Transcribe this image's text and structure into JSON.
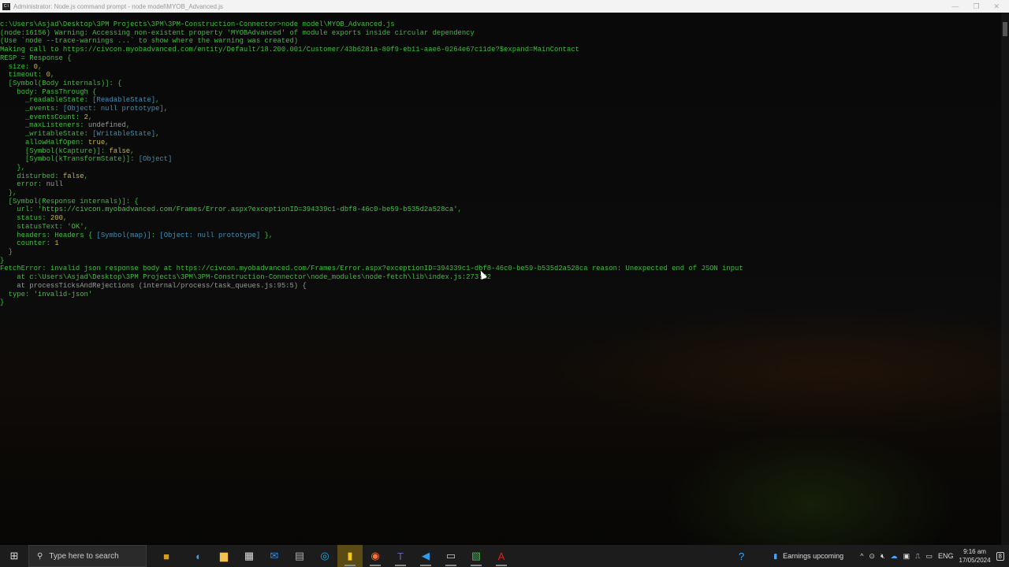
{
  "window": {
    "title": "Administrator: Node.js command prompt - node  model\\MYOB_Advanced.js",
    "controls": [
      "—",
      "❐",
      "✕"
    ]
  },
  "terminal": {
    "lines": [
      [
        [
          "c:\\Users\\Asjad\\Desktop\\3PM Projects\\3PM\\3PM-Construction-Connector>node model\\MYOB_Advanced.js",
          "g"
        ]
      ],
      [
        [
          "(node:16156) Warning: Accessing non-existent property 'MYOBAdvanced' of module exports inside circular dependency",
          "g"
        ]
      ],
      [
        [
          "(Use `node --trace-warnings ...` to show where the warning was created)",
          "g"
        ]
      ],
      [
        [
          "Making call to https://civcon.myobadvanced.com/entity/Default/18.200.001/Customer/43b6281a-80f9-eb11-aae6-0264e67c11de?$expand=MainContact",
          "g"
        ]
      ],
      [
        [
          "RESP = Response {",
          "g"
        ]
      ],
      [
        [
          "  size: ",
          "g"
        ],
        [
          "0",
          "y"
        ],
        [
          ",",
          "g"
        ]
      ],
      [
        [
          "  timeout: ",
          "g"
        ],
        [
          "0",
          "y"
        ],
        [
          ",",
          "g"
        ]
      ],
      [
        [
          "  [Symbol(Body internals)]: {",
          "g"
        ]
      ],
      [
        [
          "    body: PassThrough {",
          "g"
        ]
      ],
      [
        [
          "      _readableState: ",
          "g"
        ],
        [
          "[ReadableState]",
          "b"
        ],
        [
          ",",
          "g"
        ]
      ],
      [
        [
          "      _events: ",
          "g"
        ],
        [
          "[Object: null prototype]",
          "b"
        ],
        [
          ",",
          "g"
        ]
      ],
      [
        [
          "      _eventsCount: ",
          "g"
        ],
        [
          "2",
          "y"
        ],
        [
          ",",
          "g"
        ]
      ],
      [
        [
          "      _maxListeners: ",
          "g"
        ],
        [
          "undefined",
          "w"
        ],
        [
          ",",
          "g"
        ]
      ],
      [
        [
          "      _writableState: ",
          "g"
        ],
        [
          "[WritableState]",
          "b"
        ],
        [
          ",",
          "g"
        ]
      ],
      [
        [
          "      allowHalfOpen: ",
          "g"
        ],
        [
          "true",
          "y"
        ],
        [
          ",",
          "g"
        ]
      ],
      [
        [
          "      [Symbol(kCapture)]: ",
          "g"
        ],
        [
          "false",
          "y"
        ],
        [
          ",",
          "g"
        ]
      ],
      [
        [
          "      [Symbol(kTransformState)]: ",
          "g"
        ],
        [
          "[Object]",
          "b"
        ]
      ],
      [
        [
          "    },",
          "g"
        ]
      ],
      [
        [
          "    disturbed: ",
          "g"
        ],
        [
          "false",
          "y"
        ],
        [
          ",",
          "g"
        ]
      ],
      [
        [
          "    error: ",
          "g"
        ],
        [
          "null",
          "w"
        ]
      ],
      [
        [
          "  },",
          "g"
        ]
      ],
      [
        [
          "  [Symbol(Response internals)]: {",
          "g"
        ]
      ],
      [
        [
          "    url: ",
          "g"
        ],
        [
          "'https://civcon.myobadvanced.com/Frames/Error.aspx?exceptionID=394339c1-dbf8-46c0-be59-b535d2a528ca'",
          "gs"
        ],
        [
          ",",
          "g"
        ]
      ],
      [
        [
          "    status: ",
          "g"
        ],
        [
          "200",
          "y"
        ],
        [
          ",",
          "g"
        ]
      ],
      [
        [
          "    statusText: ",
          "g"
        ],
        [
          "'OK'",
          "gs"
        ],
        [
          ",",
          "g"
        ]
      ],
      [
        [
          "    headers: Headers { ",
          "g"
        ],
        [
          "[Symbol(map)]",
          "b"
        ],
        [
          ": ",
          "g"
        ],
        [
          "[Object: null prototype]",
          "b"
        ],
        [
          " },",
          "g"
        ]
      ],
      [
        [
          "    counter: ",
          "g"
        ],
        [
          "1",
          "y"
        ]
      ],
      [
        [
          "  }",
          "g"
        ]
      ],
      [
        [
          "}",
          "g"
        ]
      ],
      [
        [
          "FetchError: invalid json response body at https://civcon.myobadvanced.com/Frames/Error.aspx?exceptionID=394339c1-dbf8-46c0-be59-b535d2a528ca reason: Unexpected end of JSON input",
          "g"
        ]
      ],
      [
        [
          "    at c:\\Users\\Asjad\\Desktop\\3PM Projects\\3PM\\3PM-Construction-Connector\\node_modules\\node-fetch\\lib\\index.js:273:32",
          "g"
        ]
      ],
      [
        [
          "    at processTicksAndRejections (internal/process/task_queues.js:95:5) {",
          "w"
        ]
      ],
      [
        [
          "  type: ",
          "g"
        ],
        [
          "'invalid-json'",
          "gs"
        ]
      ],
      [
        [
          "}",
          "g"
        ]
      ]
    ]
  },
  "taskbar": {
    "search_placeholder": "Type here to search",
    "apps": [
      "edge",
      "file-explorer",
      "store",
      "mail",
      "calculator",
      "sync",
      "sticky-notes",
      "firefox",
      "teams",
      "vscode",
      "terminal",
      "excel-viewer",
      "acrobat"
    ],
    "app_glyphs": [
      "◐",
      "▆",
      "▦",
      "✉",
      "▤",
      "◎",
      "▮",
      "◉",
      "T",
      "◀",
      "▭",
      "▧",
      "A"
    ],
    "news": "Earnings upcoming",
    "language": "ENG",
    "time": "9:16 am",
    "date": "17/05/2024",
    "notifications": "8"
  }
}
